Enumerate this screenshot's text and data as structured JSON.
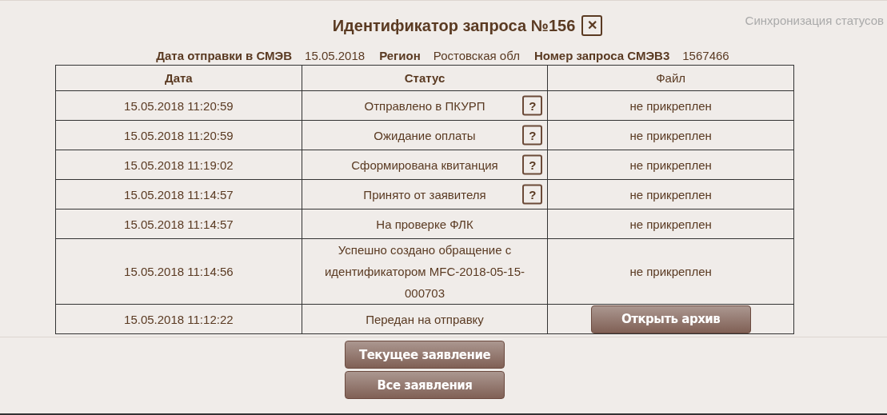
{
  "title": "Идентификатор запроса №156",
  "close": "✕",
  "sync_link": "Синхронизация статусов",
  "meta": [
    {
      "label": "Дата отправки в СМЭВ",
      "value": "15.05.2018"
    },
    {
      "label": "Регион",
      "value": "Ростовская обл"
    },
    {
      "label": "Номер запроса СМЭВ3",
      "value": "1567466"
    }
  ],
  "table": {
    "columns": [
      {
        "label": "Дата",
        "bold": true
      },
      {
        "label": "Статус",
        "bold": true
      },
      {
        "label": "Файл",
        "bold": false
      }
    ],
    "rows": [
      {
        "date": "15.05.2018 11:20:59",
        "status": "Отправлено в ПКУРП",
        "help": "?",
        "file": {
          "kind": "text",
          "text": "не прикреплен"
        }
      },
      {
        "date": "15.05.2018 11:20:59",
        "status": "Ожидание оплаты",
        "help": "?",
        "file": {
          "kind": "text",
          "text": "не прикреплен"
        }
      },
      {
        "date": "15.05.2018 11:19:02",
        "status": "Сформирована квитанция",
        "help": "?",
        "file": {
          "kind": "text",
          "text": "не прикреплен"
        }
      },
      {
        "date": "15.05.2018 11:14:57",
        "status": "Принято от заявителя",
        "help": "?",
        "file": {
          "kind": "text",
          "text": "не прикреплен"
        }
      },
      {
        "date": "15.05.2018 11:14:57",
        "status": "На проверке ФЛК",
        "file": {
          "kind": "text",
          "text": "не прикреплен"
        }
      },
      {
        "date": "15.05.2018 11:14:56",
        "status": "Успешно создано обращение с идентификатором MFC-2018-05-15-000703",
        "file": {
          "kind": "text",
          "text": "не прикреплен"
        }
      },
      {
        "date": "15.05.2018 11:12:22",
        "status": "Передан на отправку",
        "file": {
          "kind": "button",
          "text": "Открыть архив"
        }
      }
    ]
  },
  "buttons": [
    "Текущее заявление",
    "Все заявления"
  ]
}
